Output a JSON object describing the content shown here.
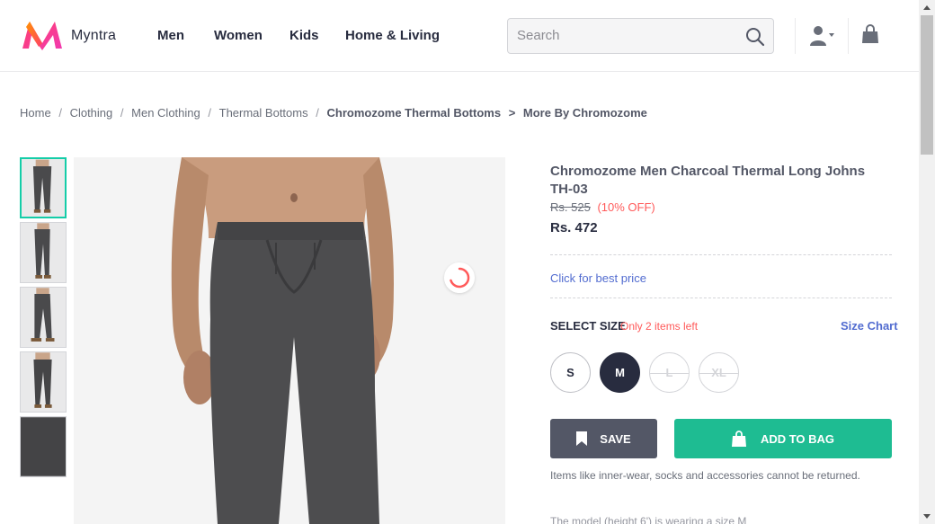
{
  "header": {
    "brand": "Myntra",
    "nav": [
      "Men",
      "Women",
      "Kids",
      "Home & Living"
    ],
    "search_placeholder": "Search"
  },
  "breadcrumb": {
    "items": [
      "Home",
      "Clothing",
      "Men Clothing",
      "Thermal Bottoms"
    ],
    "current": "Chromozome Thermal Bottoms",
    "more": "More By Chromozome",
    "sep": "/",
    "arrow": ">"
  },
  "product": {
    "title": "Chromozome Men Charcoal Thermal Long Johns TH-03",
    "mrp": "Rs. 525",
    "discount": "(10% OFF)",
    "price": "Rs. 472",
    "best_price_link": "Click for best price",
    "select_size_label": "SELECT SIZE",
    "stock_note": "Only 2 items left",
    "size_chart_link": "Size Chart",
    "sizes": [
      {
        "label": "S",
        "state": "available"
      },
      {
        "label": "M",
        "state": "selected"
      },
      {
        "label": "L",
        "state": "unavailable"
      },
      {
        "label": "XL",
        "state": "unavailable"
      }
    ],
    "save_label": "SAVE",
    "add_to_bag_label": "ADD TO BAG",
    "return_note": "Items like inner-wear, socks and accessories cannot be returned.",
    "model_note": "The model (height 6') is wearing a size M"
  },
  "gallery": {
    "thumbnail_count": 5,
    "active_index": 0
  },
  "colors": {
    "accent_teal": "#14cda8",
    "add_to_bag": "#1ebc92",
    "save": "#535766",
    "link_blue": "#526cd0",
    "discount_red": "#ff5a5a",
    "text_dark": "#282c3f"
  },
  "icons": {
    "logo": "myntra-logo",
    "search": "search-icon",
    "profile": "user-icon",
    "bag": "shopping-bag-icon",
    "save": "bookmark-icon",
    "add_to_bag": "bag-icon",
    "loading": "spinner-icon"
  }
}
